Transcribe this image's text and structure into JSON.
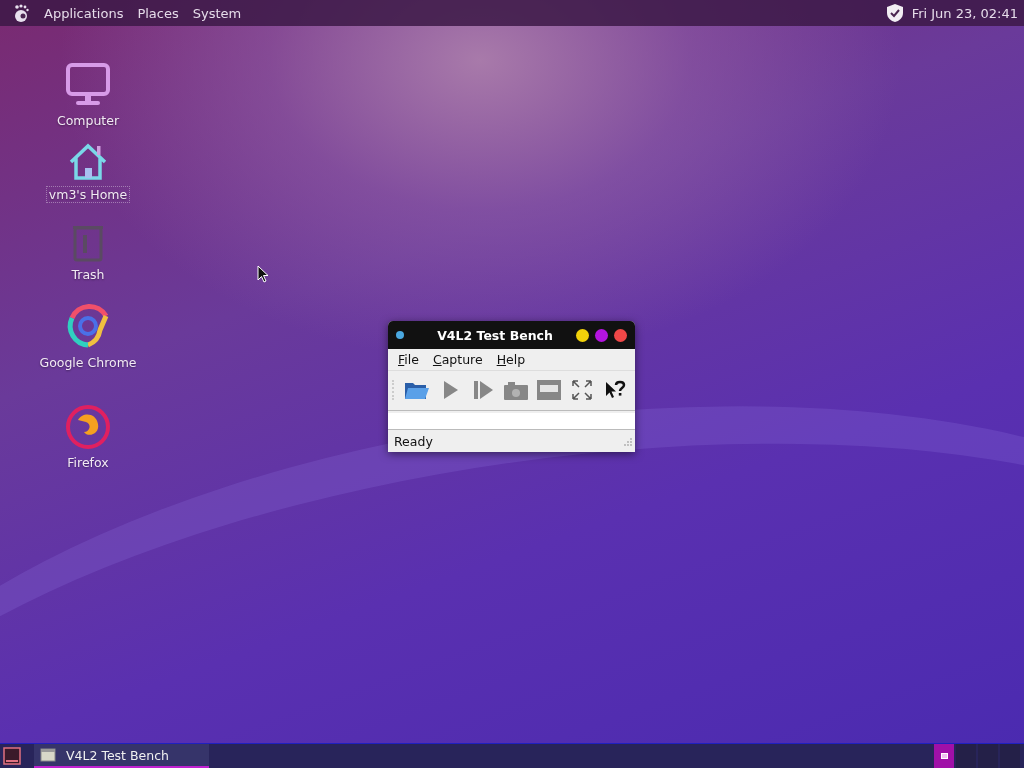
{
  "top_panel": {
    "menus": [
      "Applications",
      "Places",
      "System"
    ],
    "clock": "Fri Jun 23, 02:41"
  },
  "desktop_icons": [
    {
      "kind": "computer",
      "label": "Computer",
      "selected": false
    },
    {
      "kind": "home",
      "label": "vm3's Home",
      "selected": true
    },
    {
      "kind": "trash",
      "label": "Trash",
      "selected": false
    },
    {
      "kind": "chrome",
      "label": "Google Chrome",
      "selected": false
    },
    {
      "kind": "firefox",
      "label": "Firefox",
      "selected": false
    }
  ],
  "window": {
    "title": "V4L2 Test Bench",
    "menus": [
      "File",
      "Capture",
      "Help"
    ],
    "toolbar": [
      {
        "kind": "open",
        "disabled": false
      },
      {
        "kind": "play",
        "disabled": true
      },
      {
        "kind": "step",
        "disabled": true
      },
      {
        "kind": "snapshot",
        "disabled": true
      },
      {
        "kind": "raw",
        "disabled": true
      },
      {
        "kind": "fullscreen",
        "disabled": false
      },
      {
        "kind": "whats-this",
        "disabled": false
      }
    ],
    "status": "Ready"
  },
  "taskbar": {
    "tasks": [
      {
        "label": "V4L2 Test Bench",
        "selected": true
      }
    ],
    "workspaces": [
      {
        "selected": true
      },
      {
        "selected": false
      },
      {
        "selected": false
      },
      {
        "selected": false
      }
    ]
  }
}
